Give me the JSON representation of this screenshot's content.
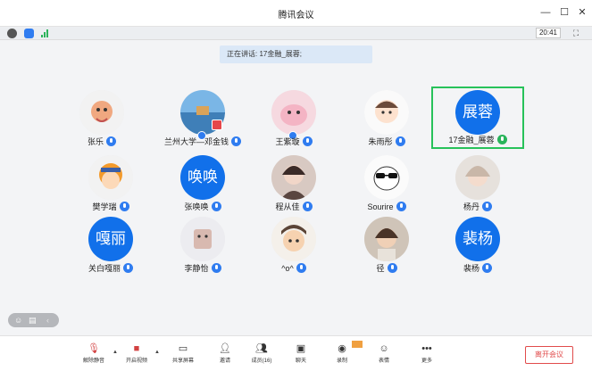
{
  "window": {
    "title": "腾讯会议",
    "min_icon": "minimize-icon",
    "max_icon": "maximize-icon",
    "close_icon": "close-icon"
  },
  "status": {
    "time": "20:41",
    "icons": [
      "info-icon",
      "shield-icon",
      "signal-icon",
      "fullscreen-icon"
    ],
    "colors": {
      "info": "#555555",
      "shield": "#2f7cf0",
      "signal": "#2bb35a"
    }
  },
  "speaking": "正在讲话: 17金融_展蓉;",
  "participants": [
    {
      "name": "张乐",
      "avatar_text": ""
    },
    {
      "name": "兰州大学—邓金钱",
      "avatar_text": ""
    },
    {
      "name": "王紫璇",
      "avatar_text": ""
    },
    {
      "name": "朱雨彤",
      "avatar_text": ""
    },
    {
      "name": "17金融_展蓉",
      "avatar_text": "展蓉"
    },
    {
      "name": "樊学瑞",
      "avatar_text": ""
    },
    {
      "name": "张唤唤",
      "avatar_text": "唤唤"
    },
    {
      "name": "程从佳",
      "avatar_text": ""
    },
    {
      "name": "Sourire",
      "avatar_text": ""
    },
    {
      "name": "杨丹",
      "avatar_text": ""
    },
    {
      "name": "关白嘎丽",
      "avatar_text": "嘎丽"
    },
    {
      "name": "李静怡",
      "avatar_text": ""
    },
    {
      "name": "^o^",
      "avatar_text": ""
    },
    {
      "name": "径",
      "avatar_text": ""
    },
    {
      "name": "裴杨",
      "avatar_text": "裴杨"
    }
  ],
  "toolbar": {
    "mute": "解除静音",
    "video": "开启视频",
    "share": "共享屏幕",
    "invite": "邀请",
    "members": "成员(16)",
    "chat": "聊天",
    "record": "录制",
    "emoji": "表情",
    "more": "更多",
    "leave": "离开会议"
  },
  "colors": {
    "accent": "#1170ea",
    "active_border": "#27c25a",
    "leave": "#e14b4b"
  }
}
